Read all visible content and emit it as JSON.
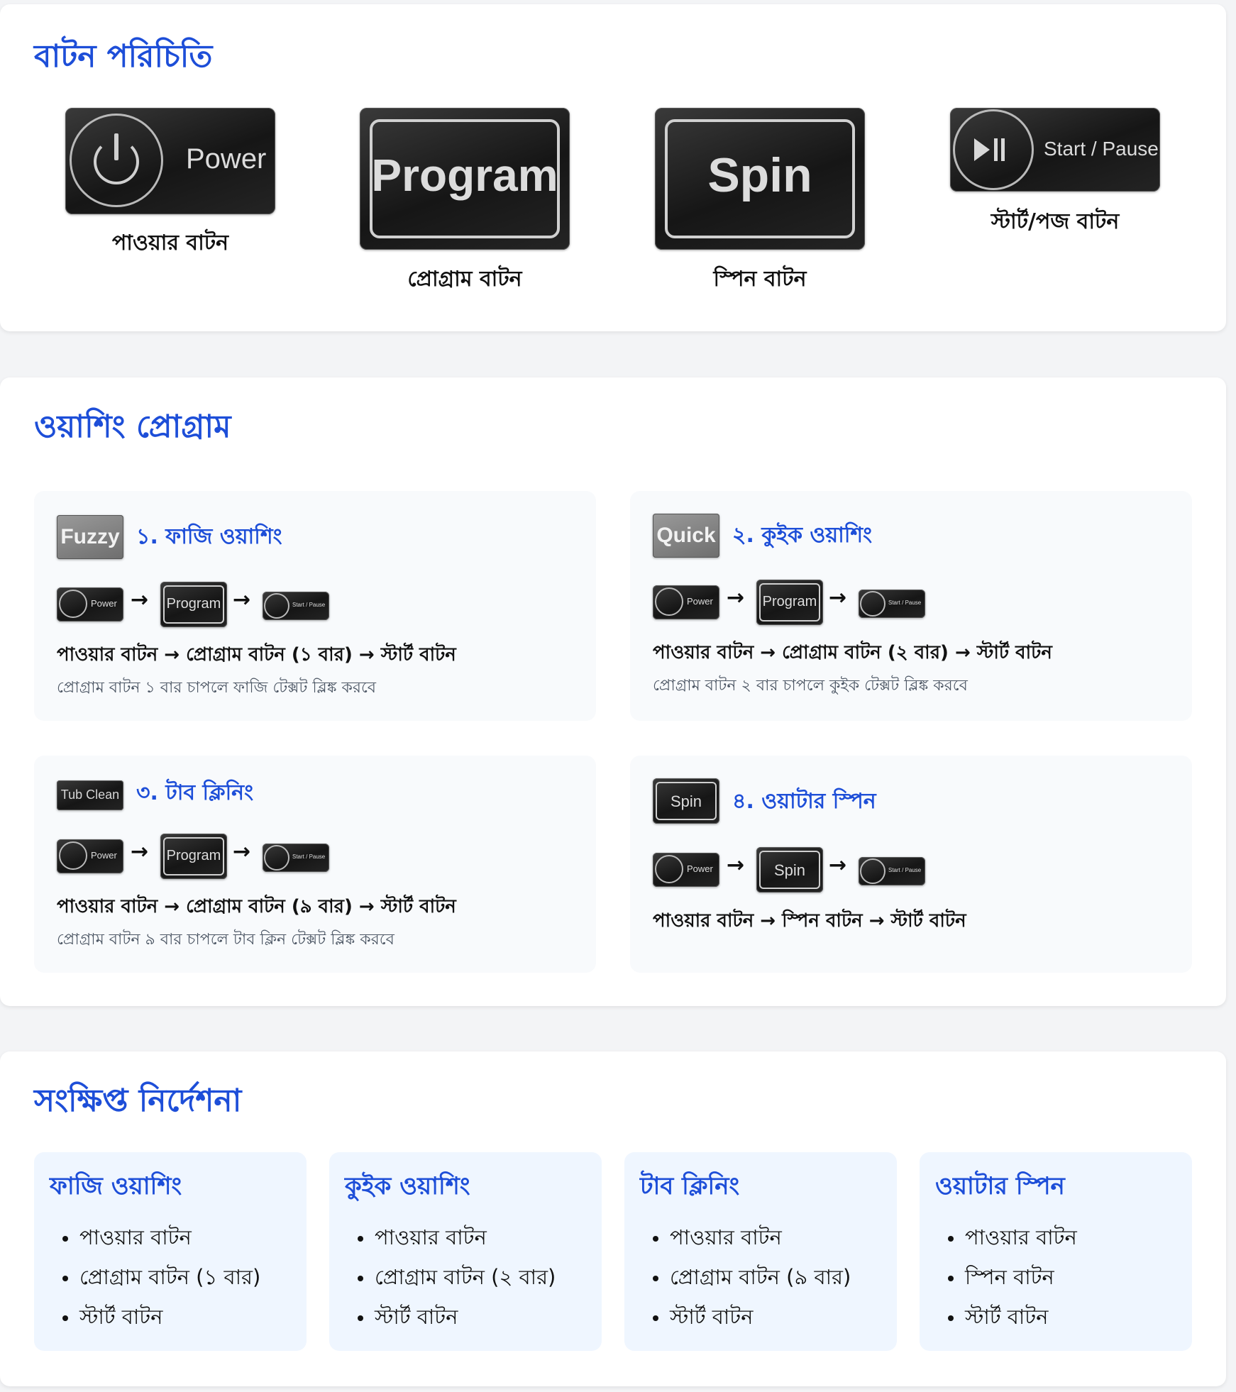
{
  "buttons_section": {
    "title": "বাটন পরিচিতি",
    "buttons": [
      {
        "image_text": "Power",
        "caption": "পাওয়ার বাটন",
        "icon": "power-icon"
      },
      {
        "image_text": "Program",
        "caption": "প্রোগ্রাম বাটন",
        "icon": ""
      },
      {
        "image_text": "Spin",
        "caption": "স্পিন বাটন",
        "icon": ""
      },
      {
        "image_text": "Start / Pause",
        "caption": "স্টার্ট/পজ বাটন",
        "icon": "play-pause-icon"
      }
    ]
  },
  "programs_section": {
    "title": "ওয়াশিং প্রোগ্রাম",
    "arrow": "→",
    "programs": [
      {
        "badge": "Fuzzy",
        "title": "১. ফাজি ওয়াশিং",
        "sequence": [
          "Power",
          "Program",
          "Start / Pause"
        ],
        "steps": "পাওয়ার বাটন → প্রোগ্রাম বাটন (১ বার) → স্টার্ট বাটন",
        "note": "প্রোগ্রাম বাটন ১ বার চাপলে ফাজি টেক্সট ব্লিঙ্ক করবে"
      },
      {
        "badge": "Quick",
        "title": "২. কুইক ওয়াশিং",
        "sequence": [
          "Power",
          "Program",
          "Start / Pause"
        ],
        "steps": "পাওয়ার বাটন → প্রোগ্রাম বাটন (২ বার) → স্টার্ট বাটন",
        "note": "প্রোগ্রাম বাটন ২ বার চাপলে কুইক টেক্সট ব্লিঙ্ক করবে"
      },
      {
        "badge": "Tub Clean",
        "title": "৩. টাব ক্লিনিং",
        "sequence": [
          "Power",
          "Program",
          "Start / Pause"
        ],
        "steps": "পাওয়ার বাটন → প্রোগ্রাম বাটন (৯ বার) → স্টার্ট বাটন",
        "note": "প্রোগ্রাম বাটন ৯ বার চাপলে টাব ক্লিন টেক্সট ব্লিঙ্ক করবে"
      },
      {
        "badge": "Spin",
        "title": "৪. ওয়াটার স্পিন",
        "sequence": [
          "Power",
          "Spin",
          "Start / Pause"
        ],
        "steps": "পাওয়ার বাটন → স্পিন বাটন → স্টার্ট বাটন",
        "note": ""
      }
    ]
  },
  "summary_section": {
    "title": "সংক্ষিপ্ত নির্দেশনা",
    "cards": [
      {
        "title": "ফাজি ওয়াশিং",
        "items": [
          "পাওয়ার বাটন",
          "প্রোগ্রাম বাটন (১ বার)",
          "স্টার্ট বাটন"
        ]
      },
      {
        "title": "কুইক ওয়াশিং",
        "items": [
          "পাওয়ার বাটন",
          "প্রোগ্রাম বাটন (২ বার)",
          "স্টার্ট বাটন"
        ]
      },
      {
        "title": "টাব ক্লিনিং",
        "items": [
          "পাওয়ার বাটন",
          "প্রোগ্রাম বাটন (৯ বার)",
          "স্টার্ট বাটন"
        ]
      },
      {
        "title": "ওয়াটার স্পিন",
        "items": [
          "পাওয়ার বাটন",
          "স্পিন বাটন",
          "স্টার্ট বাটন"
        ]
      }
    ]
  },
  "colors": {
    "accent": "#1d4ed8",
    "page_background": "#f3f4f6",
    "card_background": "#ffffff",
    "program_box_background": "#f8fafc",
    "summary_box_background": "#eff6ff",
    "button_image_background": "#1a1a1a"
  }
}
